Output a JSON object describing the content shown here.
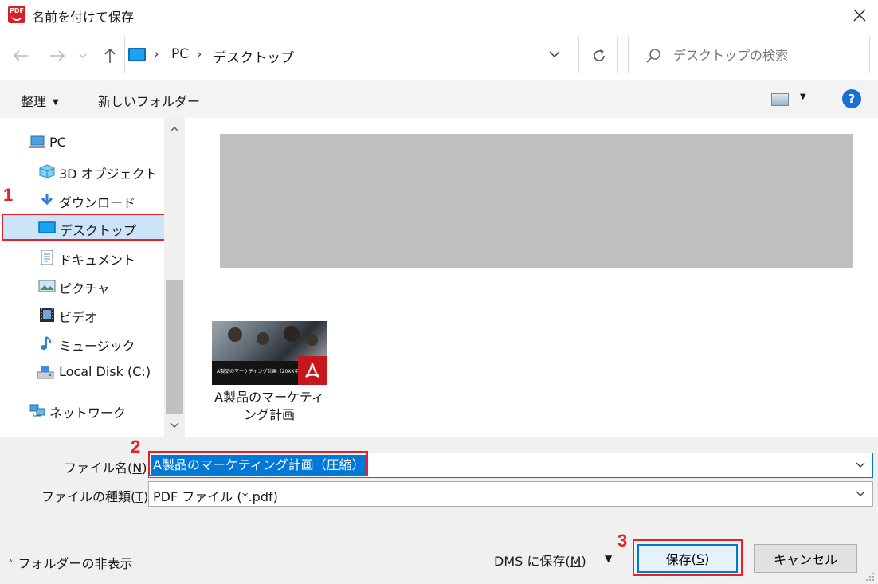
{
  "window": {
    "title": "名前を付けて保存",
    "app_icon_text": "PDF"
  },
  "navigation": {
    "address_path": [
      "PC",
      "デスクトップ"
    ],
    "search_placeholder": "デスクトップの検索"
  },
  "toolbar": {
    "organize_label": "整理",
    "new_folder_label": "新しいフォルダー",
    "help_label": "?"
  },
  "sidebar": {
    "items": [
      {
        "label": "PC",
        "icon": "pc-icon"
      },
      {
        "label": "3D オブジェクト",
        "icon": "3d-objects-icon"
      },
      {
        "label": "ダウンロード",
        "icon": "download-icon"
      },
      {
        "label": "デスクトップ",
        "icon": "desktop-icon",
        "selected": true
      },
      {
        "label": "ドキュメント",
        "icon": "documents-icon"
      },
      {
        "label": "ピクチャ",
        "icon": "pictures-icon"
      },
      {
        "label": "ビデオ",
        "icon": "videos-icon"
      },
      {
        "label": "ミュージック",
        "icon": "music-icon"
      },
      {
        "label": "Local Disk (C:)",
        "icon": "disk-icon"
      },
      {
        "label": "ネットワーク",
        "icon": "network-icon"
      }
    ]
  },
  "files": [
    {
      "name_line1": "A製品のマーケティ",
      "name_line2": "ング計画",
      "thumb_caption": "A製品のマーケティング計画（20XX年）"
    }
  ],
  "form": {
    "filename_label": "ファイル名",
    "filename_access": "N",
    "filename_value": "A製品のマーケティング計画（圧縮）",
    "filetype_label": "ファイルの種類",
    "filetype_access": "T",
    "filetype_value": "PDF ファイル (*.pdf)"
  },
  "footer": {
    "hide_folders_label": "フォルダーの非表示",
    "dms_label": "DMS に保存",
    "dms_access": "M",
    "save_label": "保存",
    "save_access": "S",
    "cancel_label": "キャンセル"
  },
  "annotations": {
    "step1": "1",
    "step2": "2",
    "step3": "3"
  },
  "colors": {
    "highlight_red": "#e8202a",
    "selection_blue": "#0078d7",
    "folder_blue": "#1aa3f0"
  }
}
